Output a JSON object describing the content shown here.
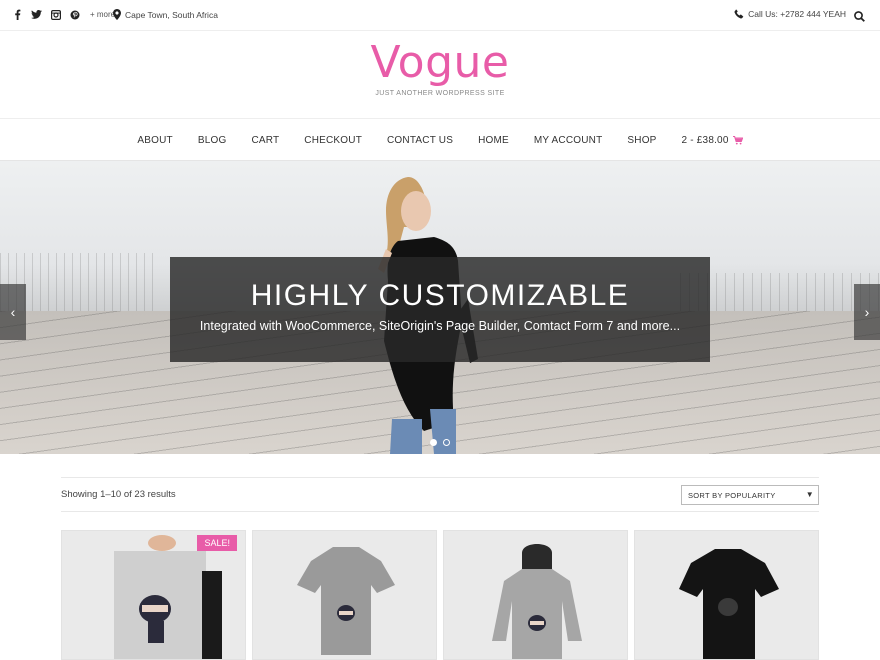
{
  "topbar": {
    "social_icons": [
      "facebook-icon",
      "twitter-icon",
      "instagram-icon",
      "pinterest-icon"
    ],
    "more": "+ more",
    "location": "Cape Town, South Africa",
    "call": "Call Us: +2782 444 YEAH"
  },
  "brand": {
    "logo": "Vogue",
    "tagline": "JUST ANOTHER WORDPRESS SITE"
  },
  "nav": {
    "items": [
      "ABOUT",
      "BLOG",
      "CART",
      "CHECKOUT",
      "CONTACT US",
      "HOME",
      "MY ACCOUNT",
      "SHOP"
    ],
    "cart": "2 - £38.00"
  },
  "hero": {
    "title": "HIGHLY CUSTOMIZABLE",
    "subtitle": "Integrated with WooCommerce, SiteOrigin's Page Builder, Comtact Form 7 and more...",
    "slide_count": 2,
    "active_slide": 1
  },
  "shop": {
    "result_count": "Showing 1–10 of 23 results",
    "sort_selected": "SORT BY POPULARITY",
    "products": [
      {
        "kind": "poster",
        "sale": "SALE!"
      },
      {
        "kind": "tshirt-grey"
      },
      {
        "kind": "hoodie"
      },
      {
        "kind": "tshirt-black"
      }
    ]
  },
  "colors": {
    "accent": "#e85ca8",
    "caption_bg": "#282828"
  }
}
